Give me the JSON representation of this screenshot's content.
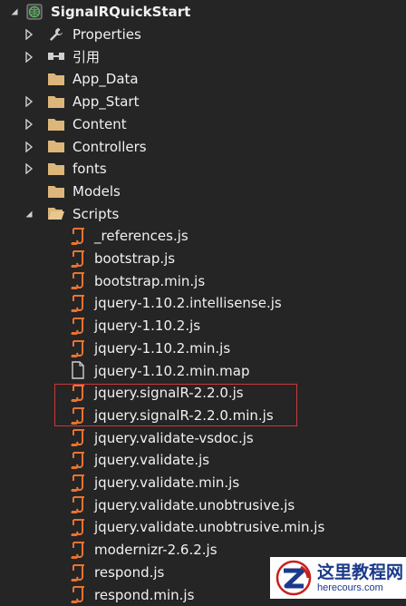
{
  "solution_explorer": {
    "items": [
      {
        "label": "SignalRQuickStart",
        "icon": "web-project-icon",
        "arrow": "expanded",
        "level": 0,
        "bold": true
      },
      {
        "label": "Properties",
        "icon": "wrench-icon",
        "arrow": "collapsed",
        "level": 1
      },
      {
        "label": "引用",
        "icon": "references-icon",
        "arrow": "collapsed",
        "level": 1
      },
      {
        "label": "App_Data",
        "icon": "folder-icon",
        "arrow": "none",
        "level": 1
      },
      {
        "label": "App_Start",
        "icon": "folder-icon",
        "arrow": "collapsed",
        "level": 1
      },
      {
        "label": "Content",
        "icon": "folder-icon",
        "arrow": "collapsed",
        "level": 1
      },
      {
        "label": "Controllers",
        "icon": "folder-icon",
        "arrow": "collapsed",
        "level": 1
      },
      {
        "label": "fonts",
        "icon": "folder-icon",
        "arrow": "collapsed",
        "level": 1
      },
      {
        "label": "Models",
        "icon": "folder-icon",
        "arrow": "none",
        "level": 1
      },
      {
        "label": "Scripts",
        "icon": "folder-open-icon",
        "arrow": "expanded",
        "level": 1
      },
      {
        "label": "_references.js",
        "icon": "js-file-icon",
        "arrow": "none",
        "level": 2
      },
      {
        "label": "bootstrap.js",
        "icon": "js-file-icon",
        "arrow": "none",
        "level": 2
      },
      {
        "label": "bootstrap.min.js",
        "icon": "js-file-icon",
        "arrow": "none",
        "level": 2
      },
      {
        "label": "jquery-1.10.2.intellisense.js",
        "icon": "js-file-icon",
        "arrow": "none",
        "level": 2
      },
      {
        "label": "jquery-1.10.2.js",
        "icon": "js-file-icon",
        "arrow": "none",
        "level": 2
      },
      {
        "label": "jquery-1.10.2.min.js",
        "icon": "js-file-icon",
        "arrow": "none",
        "level": 2
      },
      {
        "label": "jquery-1.10.2.min.map",
        "icon": "generic-file-icon",
        "arrow": "none",
        "level": 2
      },
      {
        "label": "jquery.signalR-2.2.0.js",
        "icon": "js-file-icon",
        "arrow": "none",
        "level": 2,
        "highlighted": true
      },
      {
        "label": "jquery.signalR-2.2.0.min.js",
        "icon": "js-file-icon",
        "arrow": "none",
        "level": 2,
        "highlighted": true
      },
      {
        "label": "jquery.validate-vsdoc.js",
        "icon": "js-file-icon",
        "arrow": "none",
        "level": 2
      },
      {
        "label": "jquery.validate.js",
        "icon": "js-file-icon",
        "arrow": "none",
        "level": 2
      },
      {
        "label": "jquery.validate.min.js",
        "icon": "js-file-icon",
        "arrow": "none",
        "level": 2
      },
      {
        "label": "jquery.validate.unobtrusive.js",
        "icon": "js-file-icon",
        "arrow": "none",
        "level": 2
      },
      {
        "label": "jquery.validate.unobtrusive.min.js",
        "icon": "js-file-icon",
        "arrow": "none",
        "level": 2
      },
      {
        "label": "modernizr-2.6.2.js",
        "icon": "js-file-icon",
        "arrow": "none",
        "level": 2
      },
      {
        "label": "respond.js",
        "icon": "js-file-icon",
        "arrow": "none",
        "level": 2
      },
      {
        "label": "respond.min.js",
        "icon": "js-file-icon",
        "arrow": "none",
        "level": 2
      }
    ]
  },
  "watermark": {
    "title": "这里教程网",
    "url": "herecours.com"
  },
  "colors": {
    "background": "#252526",
    "text": "#f1f1f1",
    "folder": "#dcb67a",
    "js_icon": "#e8732f",
    "highlight_border": "#c83a3a"
  }
}
